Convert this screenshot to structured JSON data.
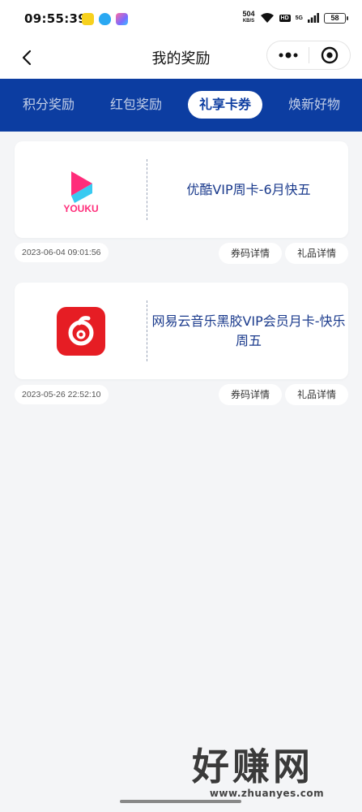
{
  "status_bar": {
    "time": "09:55:39",
    "net_speed": "504",
    "net_unit": "KB/S",
    "hd": "HD",
    "sig": "5G",
    "battery": "58"
  },
  "nav": {
    "title": "我的奖励",
    "back_icon": "chevron-left-icon",
    "more_icon": "more-dots-icon",
    "close_icon": "target-close-icon"
  },
  "tabs": [
    {
      "label": "积分奖励",
      "active": false
    },
    {
      "label": "红包奖励",
      "active": false
    },
    {
      "label": "礼享卡券",
      "active": true
    },
    {
      "label": "焕新好物",
      "active": false
    }
  ],
  "rewards": [
    {
      "title": "优酷VIP周卡-6月快五",
      "logo_icon": "youku-logo-icon",
      "logo_text": "YOUKU",
      "date": "2023-06-04 09:01:56",
      "coupon_btn": "券码详情",
      "gift_btn": "礼品详情"
    },
    {
      "title": "网易云音乐黑胶VIP会员月卡-快乐周五",
      "logo_icon": "netease-music-logo-icon",
      "date": "2023-05-26 22:52:10",
      "coupon_btn": "券码详情",
      "gift_btn": "礼品详情"
    }
  ],
  "watermark": {
    "big": "好赚网",
    "url": "www.zhuanyes.com"
  },
  "colors": {
    "brand_blue": "#0c3da1",
    "title_blue": "#1a3a8c",
    "background": "#f4f5f7"
  }
}
